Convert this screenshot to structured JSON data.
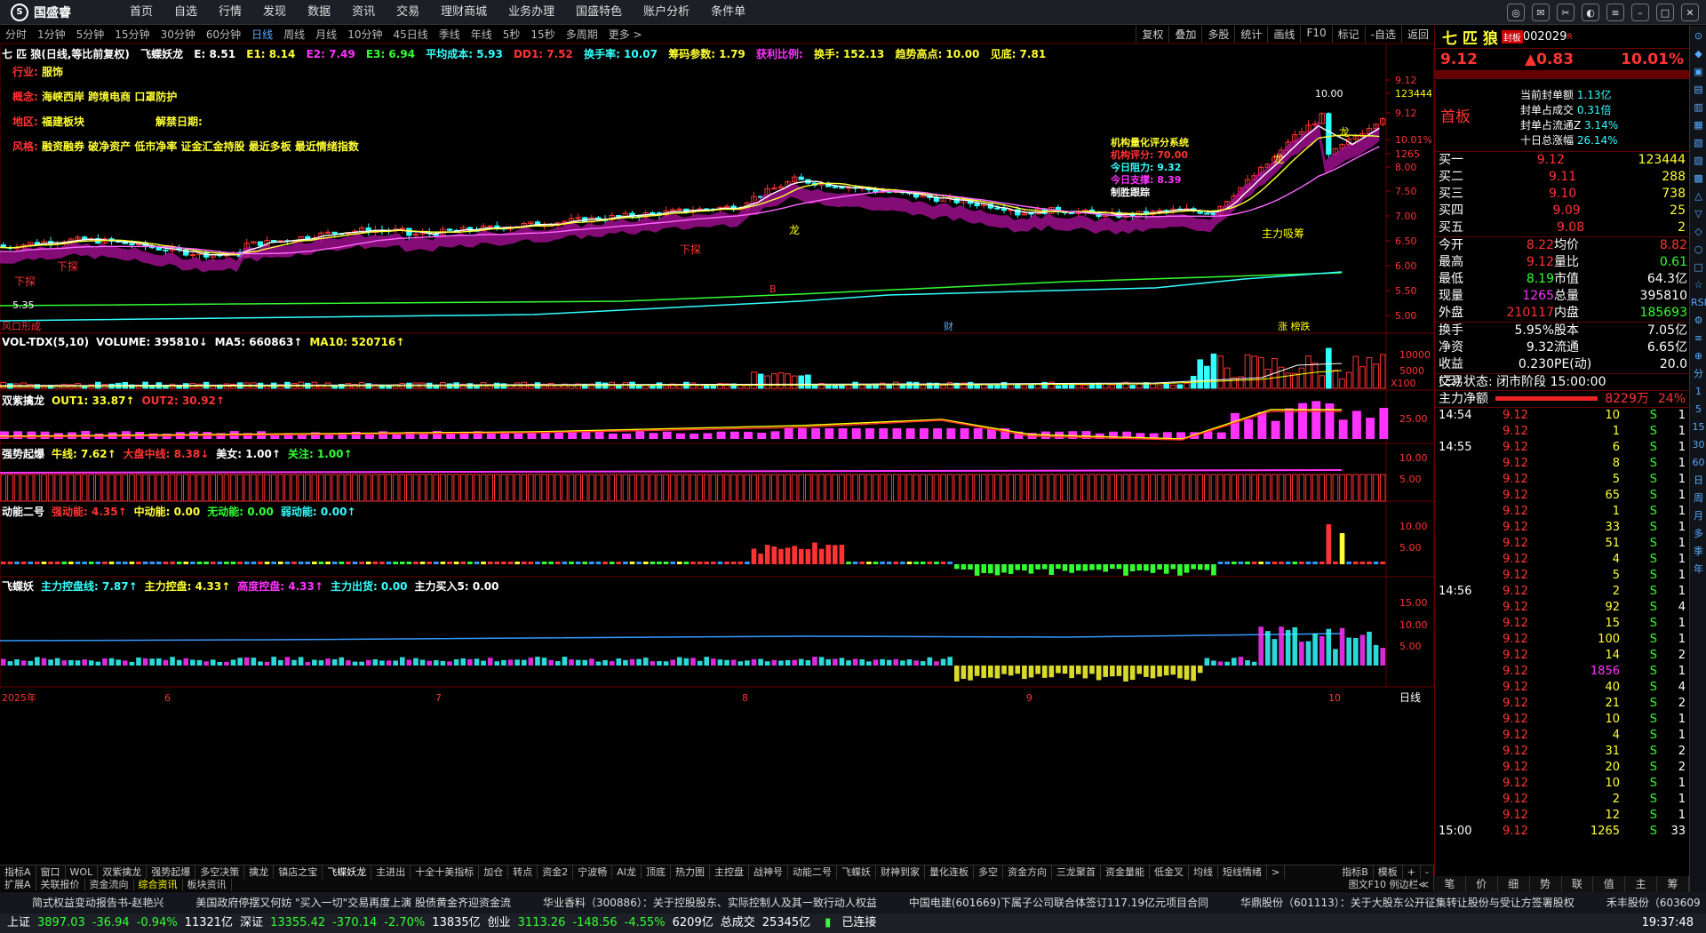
{
  "app": {
    "logo": "国盛睿"
  },
  "menu": [
    "首页",
    "自选",
    "行情",
    "发现",
    "数据",
    "资讯",
    "交易",
    "理财商城",
    "业务办理",
    "国盛特色",
    "账户分析",
    "条件单"
  ],
  "periods": [
    "分时",
    "1分钟",
    "5分钟",
    "15分钟",
    "30分钟",
    "60分钟",
    "日线",
    "周线",
    "月线",
    "10分钟",
    "45日线",
    "季线",
    "年线",
    "5秒",
    "15秒",
    "多周期",
    "更多 >"
  ],
  "active_period": "日线",
  "toolbar": [
    "复权",
    "叠加",
    "多股",
    "统计",
    "画线",
    "F10",
    "标记",
    "-自选",
    "返回"
  ],
  "main_title": {
    "name": "七 匹 狼(日线,等比前复权)",
    "ind": "飞蝶妖龙",
    "E": "E: 8.51",
    "E1": "E1: 8.14",
    "E2": "E2: 7.49",
    "E3": "E3: 6.94",
    "avg": "平均成本: 5.93",
    "dd": "DD1: 7.52",
    "hs": "换手率: 10.07",
    "cmcs": "筹码参数: 1.79",
    "hlbl": "获利比例:",
    "hs2": "换手: 152.13",
    "qs": "趋势高点: 10.00",
    "jd": "见底: 7.81"
  },
  "info": {
    "industry_label": "行业:",
    "industry": "服饰",
    "concept_label": "概念:",
    "concept": "海峡西岸 跨境电商 口罩防护",
    "region_label": "地区:",
    "region": "福建板块",
    "unlock_label": "解禁日期:",
    "style_label": "风格:",
    "style": "融资融券 破净资产 低市净率 证金汇金持股 最近多板 最近情绪指数"
  },
  "score": {
    "title": "机构量化评分系统",
    "s1": "机构评分:  70.00",
    "s2": "今日阻力:  9.32",
    "s3": "今日支撑:  8.39",
    "s4": "制胜跟踪"
  },
  "price_axis": [
    "9.12",
    "123444",
    "9.12",
    "10.01%",
    "1265",
    "8.00",
    "7.50",
    "7.00",
    "6.50",
    "6.00",
    "5.50",
    "5.00"
  ],
  "chart_marks": {
    "hi": "10.00",
    "lo": "5.35",
    "down1": "下探",
    "down2": "下探",
    "down3": "下探",
    "long1": "龙",
    "long2": "龙",
    "long3": "龙",
    "zl": "主力吸筹",
    "fkxc": "风口形成",
    "cai": "财",
    "zhang": "涨 榜跌",
    "B": "B",
    "date_axis": [
      "2025年",
      "6",
      "7",
      "8",
      "9",
      "10"
    ],
    "daily": "日线"
  },
  "vol_title": {
    "a": "VOL-TDX(5,10)",
    "b": "VOLUME: 395810↓",
    "c": "MA5: 660863↑",
    "d": "MA10: 520716↑",
    "axis": [
      "10000",
      "5000",
      "X100"
    ]
  },
  "p3": {
    "a": "双紫擒龙",
    "b": "OUT1: 33.87↑",
    "c": "OUT2: 30.92↑",
    "axis": [
      "25.00"
    ]
  },
  "p4": {
    "a": "强势起爆",
    "b": "牛线: 7.62↑",
    "c": "大盘中线: 8.38↓",
    "d": "美女: 1.00↑",
    "e": "关注: 1.00↑",
    "axis": [
      "10.00",
      "5.00"
    ]
  },
  "p5": {
    "a": "动能二号",
    "b": "强动能: 4.35↑",
    "c": "中动能: 0.00",
    "d": "无动能: 0.00",
    "e": "弱动能: 0.00↑",
    "axis": [
      "10.00",
      "5.00"
    ]
  },
  "p6": {
    "a": "飞蝶妖",
    "b": "主力控盘线: 7.87↑",
    "c": "主力控盘: 4.33↑",
    "d": "高度控盘: 4.33↑",
    "e": "主力出货: 0.00",
    "f": "主力买入5: 0.00",
    "axis": [
      "15.00",
      "10.00",
      "5.00"
    ]
  },
  "tabs1": [
    "指标A",
    "窗口",
    "WOL",
    "双紫擒龙",
    "强势起爆",
    "多空决策",
    "擒龙",
    "镇店之宝",
    "飞蝶妖龙",
    "主进出",
    "十全十美指标",
    "加仓",
    "转点",
    "资金2",
    "宁波畅",
    "AI龙",
    "顶底",
    "热力图",
    "主控盘",
    "战神号",
    "动能二号",
    "飞蝶妖",
    "财神到家",
    "量化连板",
    "多空",
    "资金方向",
    "三龙聚首",
    "资金量能",
    "低金叉",
    "均线",
    "短线情绪",
    ">",
    "指标B",
    "模板",
    "+",
    "-"
  ],
  "tabs2": [
    "扩展A",
    "关联报价",
    "资金流向",
    "综合资讯",
    "板块资讯"
  ],
  "tabs2_right": "图文F10 例边栏≪",
  "right": {
    "name": "七 匹 狼",
    "tag": "封板",
    "code": "002029",
    "r": "R",
    "price": "9.12",
    "chg": "▲0.83",
    "pct": "10.01%",
    "seal_l": [
      "当前封单额",
      "封单占成交",
      "封单占流通Z",
      "十日总涨幅"
    ],
    "seal_v": [
      "1.13亿",
      "0.31倍",
      "3.14%",
      "26.14%"
    ],
    "board": "首板",
    "buys": [
      [
        "买一",
        "9.12",
        "123444"
      ],
      [
        "买二",
        "9.11",
        "288"
      ],
      [
        "买三",
        "9.10",
        "738"
      ],
      [
        "买四",
        "9.09",
        "25"
      ],
      [
        "买五",
        "9.08",
        "2"
      ]
    ],
    "stats": [
      [
        "今开",
        "8.22",
        "均价",
        "8.82"
      ],
      [
        "最高",
        "9.12",
        "量比",
        "0.61"
      ],
      [
        "最低",
        "8.19",
        "市值",
        "64.3亿"
      ],
      [
        "现量",
        "1265",
        "总量",
        "395810"
      ],
      [
        "外盘",
        "210117",
        "内盘",
        "185693"
      ]
    ],
    "stats2": [
      [
        "换手",
        "5.95%",
        "股本",
        "7.05亿"
      ],
      [
        "净资",
        "9.32",
        "流通",
        "6.65亿"
      ],
      [
        "收益(三)",
        "0.230",
        "PE(动)",
        "20.0"
      ]
    ],
    "trade_state": "交易状态: 闭市阶段 15:00:00",
    "net_label": "主力净额",
    "net_val": "8229万",
    "net_pct": "24%",
    "ticks": [
      [
        "14:54",
        "9.12",
        "10",
        "S",
        "1"
      ],
      [
        "",
        "9.12",
        "1",
        "S",
        "1"
      ],
      [
        "14:55",
        "9.12",
        "6",
        "S",
        "1"
      ],
      [
        "",
        "9.12",
        "8",
        "S",
        "1"
      ],
      [
        "",
        "9.12",
        "5",
        "S",
        "1"
      ],
      [
        "",
        "9.12",
        "65",
        "S",
        "1"
      ],
      [
        "",
        "9.12",
        "1",
        "S",
        "1"
      ],
      [
        "",
        "9.12",
        "33",
        "S",
        "1"
      ],
      [
        "",
        "9.12",
        "51",
        "S",
        "1"
      ],
      [
        "",
        "9.12",
        "4",
        "S",
        "1"
      ],
      [
        "",
        "9.12",
        "5",
        "S",
        "1"
      ],
      [
        "14:56",
        "9.12",
        "2",
        "S",
        "1"
      ],
      [
        "",
        "9.12",
        "92",
        "S",
        "4"
      ],
      [
        "",
        "9.12",
        "15",
        "S",
        "1"
      ],
      [
        "",
        "9.12",
        "100",
        "S",
        "1"
      ],
      [
        "",
        "9.12",
        "14",
        "S",
        "2"
      ],
      [
        "",
        "9.12",
        "1856",
        "S",
        "1"
      ],
      [
        "",
        "9.12",
        "40",
        "S",
        "4"
      ],
      [
        "",
        "9.12",
        "21",
        "S",
        "2"
      ],
      [
        "",
        "9.12",
        "10",
        "S",
        "1"
      ],
      [
        "",
        "9.12",
        "4",
        "S",
        "1"
      ],
      [
        "",
        "9.12",
        "31",
        "S",
        "2"
      ],
      [
        "",
        "9.12",
        "20",
        "S",
        "2"
      ],
      [
        "",
        "9.12",
        "10",
        "S",
        "1"
      ],
      [
        "",
        "9.12",
        "2",
        "S",
        "1"
      ],
      [
        "",
        "9.12",
        "12",
        "S",
        "1"
      ],
      [
        "15:00",
        "9.12",
        "1265",
        "S",
        "33"
      ]
    ],
    "rtabs": [
      "笔",
      "价",
      "细",
      "势",
      "联",
      "值",
      "主",
      "筹"
    ]
  },
  "sidebar": [
    "⊙",
    "◆",
    "▣",
    "▤",
    "▥",
    "▦",
    "▧",
    "▨",
    "▩",
    "△",
    "▽",
    "◇",
    "○",
    "□",
    "☆",
    "RSI",
    "⚙",
    "≡",
    "⊕",
    "分",
    "1",
    "5",
    "15",
    "30",
    "60",
    "日",
    "周",
    "月",
    "多",
    "季",
    "年"
  ],
  "ticker": [
    "简式权益变动报告书-赵艳兴",
    "美国政府停摆又何妨 \"买入一切\"交易再度上演 股债黄金齐迎资金流",
    "华业香料（300886）：关于控股股东、实际控制人及其一致行动人权益",
    "中国电建(601669)下属子公司联合体签订117.19亿元项目合同",
    "华鼎股份（601113）：关于大股东公开征集转让股份与受让方签署股权",
    "禾丰股份（603609"
  ],
  "status": {
    "sh": "上证",
    "sh1": "3897.03",
    "sh2": "-36.94",
    "sh3": "-0.94%",
    "sh4": "11321亿",
    "sz": "深证",
    "sz1": "13355.42",
    "sz2": "-370.14",
    "sz3": "-2.70%",
    "sz4": "13835亿",
    "cy": "创业",
    "cy1": "3113.26",
    "cy2": "-148.56",
    "cy3": "-4.55%",
    "cy4": "6209亿",
    "tot": "总成交",
    "tot1": "25345亿",
    "conn": "已连接",
    "time": "19:37:48"
  }
}
